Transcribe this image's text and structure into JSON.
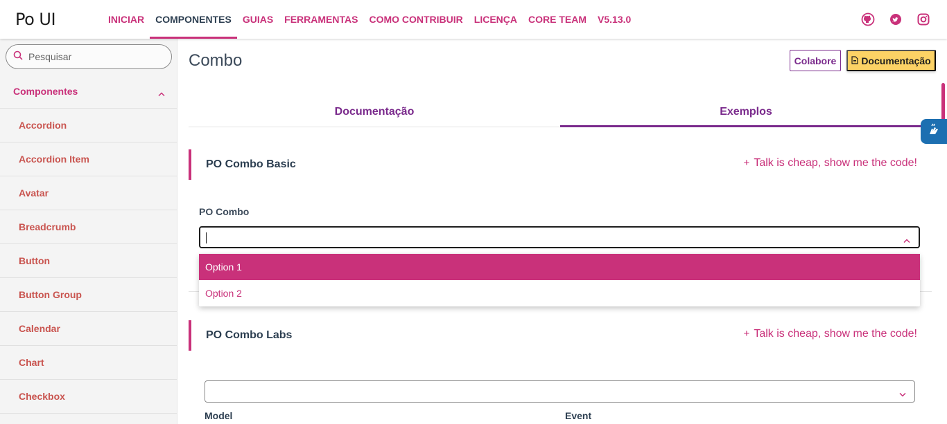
{
  "app": {
    "logo": "Po UI"
  },
  "nav": {
    "items": [
      {
        "label": "INICIAR"
      },
      {
        "label": "COMPONENTES"
      },
      {
        "label": "GUIAS"
      },
      {
        "label": "FERRAMENTAS"
      },
      {
        "label": "COMO CONTRIBUIR"
      },
      {
        "label": "LICENÇA"
      },
      {
        "label": "CORE TEAM"
      },
      {
        "label": "V5.13.0"
      }
    ],
    "active_index": 1,
    "social_icons": [
      "github-icon",
      "twitter-icon",
      "instagram-icon"
    ]
  },
  "sidebar": {
    "search_placeholder": "Pesquisar",
    "group_label": "Componentes",
    "items": [
      {
        "label": "Accordion"
      },
      {
        "label": "Accordion Item"
      },
      {
        "label": "Avatar"
      },
      {
        "label": "Breadcrumb"
      },
      {
        "label": "Button"
      },
      {
        "label": "Button Group"
      },
      {
        "label": "Calendar"
      },
      {
        "label": "Chart"
      },
      {
        "label": "Checkbox"
      }
    ]
  },
  "page": {
    "title": "Combo",
    "colabore_label": "Colabore",
    "doc_label": "Documentação"
  },
  "tabs": [
    {
      "label": "Documentação"
    },
    {
      "label": "Exemplos"
    }
  ],
  "active_tab_index": 1,
  "sections": {
    "basic": {
      "title": "PO Combo Basic",
      "code_link": "Talk is cheap, show me the code!",
      "field_label": "PO Combo",
      "input_value": "",
      "options": [
        {
          "label": "Option 1"
        },
        {
          "label": "Option 2"
        }
      ],
      "highlighted_option_index": 0
    },
    "labs": {
      "title": "PO Combo Labs",
      "code_link": "Talk is cheap, show me the code!",
      "select_value": "",
      "model_label": "Model",
      "event_label": "Event"
    }
  },
  "colors": {
    "primary": "#c9317a",
    "secondary": "#7a2a8c",
    "heading": "#2c3e50",
    "warning": "#fcd265",
    "a11y": "#1d6fb1"
  }
}
